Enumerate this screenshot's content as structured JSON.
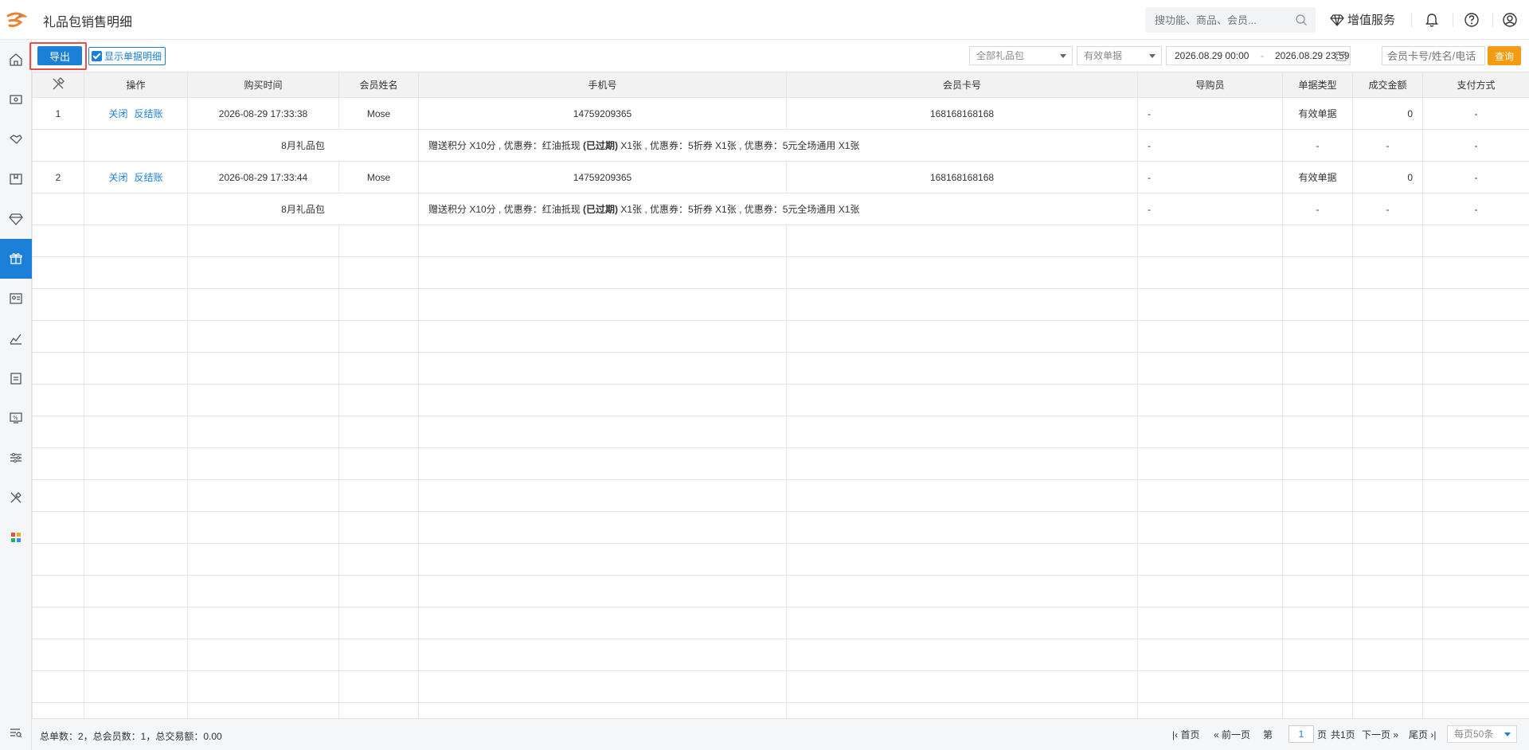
{
  "header": {
    "title": "礼品包销售明细",
    "search_placeholder": "搜功能、商品、会员...",
    "vip_label": "增值服务"
  },
  "toolbar": {
    "export_label": "导出",
    "show_detail_label": "显示单据明细",
    "show_detail_checked": true,
    "package_select": "全部礼品包",
    "status_select": "有效单据",
    "date_start": "2026.08.29 00:00",
    "date_sep": "-",
    "date_end": "2026.08.29 23:59",
    "member_placeholder": "会员卡号/姓名/电话",
    "query_label": "查询"
  },
  "table": {
    "columns": [
      "操作",
      "购买时间",
      "会员姓名",
      "手机号",
      "会员卡号",
      "导购员",
      "单据类型",
      "成交金额",
      "支付方式"
    ],
    "rows": [
      {
        "index": "1",
        "op_close": "关闭",
        "op_reverse": "反结账",
        "time": "2026-08-29 17:33:38",
        "name": "Mose",
        "phone": "14759209365",
        "card": "168168168168",
        "guide": "-",
        "type": "有效单据",
        "amount": "0",
        "pay": "-",
        "detail": {
          "package": "8月礼品包",
          "gift_a": "赠送积分 X10分 , 优惠券：红油抵现 ",
          "expired": "(已过期)",
          "gift_b": " X1张 , 优惠券：5折券 X1张 , 优惠券：5元全场通用 X1张",
          "guide": "-",
          "type": "-",
          "amount": "-",
          "pay": "-"
        }
      },
      {
        "index": "2",
        "op_close": "关闭",
        "op_reverse": "反结账",
        "time": "2026-08-29 17:33:44",
        "name": "Mose",
        "phone": "14759209365",
        "card": "168168168168",
        "guide": "-",
        "type": "有效单据",
        "amount": "0",
        "pay": "-",
        "detail": {
          "package": "8月礼品包",
          "gift_a": "赠送积分 X10分 , 优惠券：红油抵现 ",
          "expired": "(已过期)",
          "gift_b": " X1张 , 优惠券：5折券 X1张 , 优惠券：5元全场通用 X1张",
          "guide": "-",
          "type": "-",
          "amount": "-",
          "pay": "-"
        }
      }
    ]
  },
  "footer": {
    "summary": "总单数：2，总会员数：1，总交易额：0.00",
    "first": "首页",
    "prev": "前一页",
    "page_prefix": "第",
    "page_value": "1",
    "page_suffix": "页",
    "total_pages": "共1页",
    "next": "下一页",
    "last": "尾页",
    "per_page": "每页50条"
  },
  "colors": {
    "primary": "#1c7fd8",
    "query": "#f39c12",
    "highlight_border": "#ea4b4b"
  }
}
